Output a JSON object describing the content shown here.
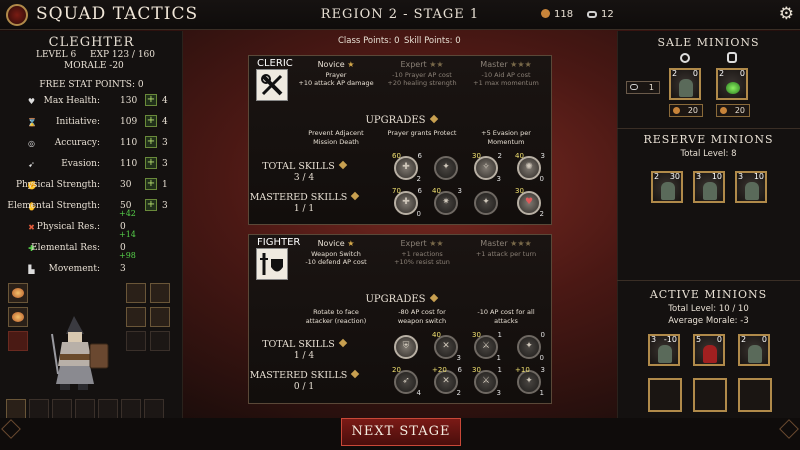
{
  "header": {
    "title": "SQUAD TACTICS",
    "region": "REGION 2 - STAGE 1",
    "gold": "118",
    "chains": "12",
    "settings_icon": "gear-icon"
  },
  "points": {
    "class_points": "Class Points: 0",
    "skill_points": "Skill Points: 0"
  },
  "character": {
    "name": "CLEGHTER",
    "level": "LEVEL 6",
    "exp": "EXP 123 / 160",
    "morale": "MORALE -20",
    "free_points": "FREE STAT POINTS: 0",
    "stats": [
      {
        "name": "Max Health:",
        "value": "130",
        "points": "4",
        "icon": "heart-icon"
      },
      {
        "name": "Initiative:",
        "value": "109",
        "points": "4",
        "icon": "hourglass-icon"
      },
      {
        "name": "Accuracy:",
        "value": "110",
        "points": "3",
        "icon": "target-icon"
      },
      {
        "name": "Evasion:",
        "value": "110",
        "points": "3",
        "icon": "evasion-icon"
      },
      {
        "name": "Physical Strength:",
        "value": "30",
        "points": "1",
        "icon": "fist-icon"
      },
      {
        "name": "Elemental Strength:",
        "value": "50",
        "points": "3",
        "bonus": "+42",
        "icon": "elemental-icon"
      },
      {
        "name": "Physical Res.:",
        "value": "0",
        "bonus": "+14",
        "icon": "physical-res-icon"
      },
      {
        "name": "Elemental Res:",
        "value": "0",
        "bonus": "+98",
        "icon": "elemental-res-icon"
      },
      {
        "name": "Movement:",
        "value": "3",
        "icon": "boot-icon"
      }
    ]
  },
  "cleric": {
    "name": "CLERIC",
    "tiers": [
      {
        "title": "Novice",
        "stars": "★",
        "desc1": "Prayer",
        "desc2": "+10 attack AP damage"
      },
      {
        "title": "Expert",
        "stars": "★★",
        "desc1": "-10 Prayer AP cost",
        "desc2": "+20 healing strength"
      },
      {
        "title": "Master",
        "stars": "★★★",
        "desc1": "-10 Aid AP cost",
        "desc2": "+1 max momentum"
      }
    ],
    "upgrades_title": "UPGRADES",
    "upgrades": [
      {
        "l1": "Prevent Adjacent",
        "l2": "Mission Death"
      },
      {
        "l1": "Prayer grants Protect",
        "l2": ""
      },
      {
        "l1": "+5 Evasion per",
        "l2": "Momentum"
      }
    ],
    "total_skills_label": "TOTAL SKILLS",
    "total_skills_count": "3 / 4",
    "mastered_skills_label": "MASTERED SKILLS",
    "mastered_skills_count": "1 / 1",
    "total_skills": [
      {
        "tl": "60",
        "tr": "6",
        "br": "2",
        "glyph": "✚"
      },
      {
        "tl": "",
        "tr": "",
        "br": "",
        "glyph": "✦"
      },
      {
        "tl": "30",
        "tr": "2",
        "br": "3",
        "glyph": "✧"
      },
      {
        "tl": "40",
        "tr": "3",
        "br": "0",
        "glyph": "✺"
      }
    ],
    "mastered_skills": [
      {
        "tl": "70",
        "tr": "6",
        "br": "0",
        "glyph": "✚"
      },
      {
        "tl": "40",
        "tr": "3",
        "br": "",
        "glyph": "✷"
      },
      {
        "tl": "",
        "tr": "",
        "br": "",
        "glyph": "✦"
      },
      {
        "tl": "30",
        "tr": "",
        "br": "2",
        "glyph": "♥"
      }
    ]
  },
  "fighter": {
    "name": "FIGHTER",
    "tiers": [
      {
        "title": "Novice",
        "stars": "★",
        "desc1": "Weapon Switch",
        "desc2": "-10 defend AP cost"
      },
      {
        "title": "Expert",
        "stars": "★★",
        "desc1": "+1 reactions",
        "desc2": "+10% resist stun"
      },
      {
        "title": "Master",
        "stars": "★★★",
        "desc1": "+1 attack per turn",
        "desc2": ""
      }
    ],
    "upgrades_title": "UPGRADES",
    "upgrades": [
      {
        "l1": "Rotate to face",
        "l2": "attacker (reaction)"
      },
      {
        "l1": "-80 AP cost for",
        "l2": "weapon switch"
      },
      {
        "l1": "-10 AP cost for all",
        "l2": "attacks"
      }
    ],
    "total_skills_label": "TOTAL SKILLS",
    "total_skills_count": "1 / 4",
    "mastered_skills_label": "MASTERED SKILLS",
    "mastered_skills_count": "0 / 1",
    "total_skills": [
      {
        "tl": "",
        "tr": "",
        "br": "",
        "glyph": "⛨"
      },
      {
        "tl": "40",
        "tr": "",
        "br": "3",
        "glyph": "✕"
      },
      {
        "tl": "30",
        "tr": "1",
        "br": "1",
        "glyph": "⚔"
      },
      {
        "tl": "",
        "tr": "0",
        "br": "0",
        "glyph": "✦"
      }
    ],
    "mastered_skills": [
      {
        "tl": "20",
        "tr": "",
        "br": "4",
        "glyph": "➶"
      },
      {
        "tl": "+20",
        "tr": "6",
        "br": "2",
        "glyph": "✕"
      },
      {
        "tl": "30",
        "tr": "1",
        "br": "3",
        "glyph": "⚔"
      },
      {
        "tl": "+10",
        "tr": "3",
        "br": "1",
        "glyph": "✦"
      }
    ]
  },
  "sale": {
    "title": "SALE MINIONS",
    "chain_count": "1",
    "minions": [
      {
        "a": "2",
        "b": "0",
        "price": "20"
      },
      {
        "a": "2",
        "b": "0",
        "price": "20"
      }
    ]
  },
  "reserve": {
    "title": "RESERVE MINIONS",
    "total_level": "Total Level: 8",
    "minions": [
      {
        "a": "2",
        "b": "30"
      },
      {
        "a": "3",
        "b": "10"
      },
      {
        "a": "3",
        "b": "10"
      }
    ]
  },
  "active": {
    "title": "ACTIVE MINIONS",
    "total_level": "Total Level: 10 / 10",
    "avg_morale": "Average Morale: -3",
    "minions": [
      {
        "a": "3",
        "b": "-10"
      },
      {
        "a": "5",
        "b": "0"
      },
      {
        "a": "2",
        "b": "0"
      }
    ]
  },
  "next_stage": "NEXT STAGE",
  "colors": {
    "accent_gold": "#b08a4a",
    "button_red": "#7a1a16",
    "bonus_green": "#56d04a"
  }
}
